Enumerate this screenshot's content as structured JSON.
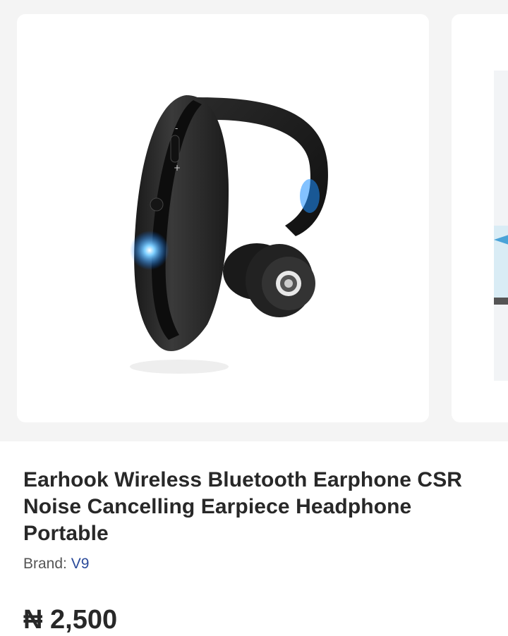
{
  "product": {
    "title": "Earhook Wireless Bluetooth Earphone CSR Noise Cancelling Earpiece Headphone Portable",
    "brand_label": "Brand:",
    "brand_name": "V9",
    "price": "₦ 2,500"
  },
  "gallery": {
    "images": [
      {
        "icon": "bluetooth-earphone-image"
      },
      {
        "icon": "next-product-image"
      }
    ]
  },
  "colors": {
    "brand_link": "#2a4a9a",
    "background": "#f4f4f4",
    "text": "#282828"
  }
}
